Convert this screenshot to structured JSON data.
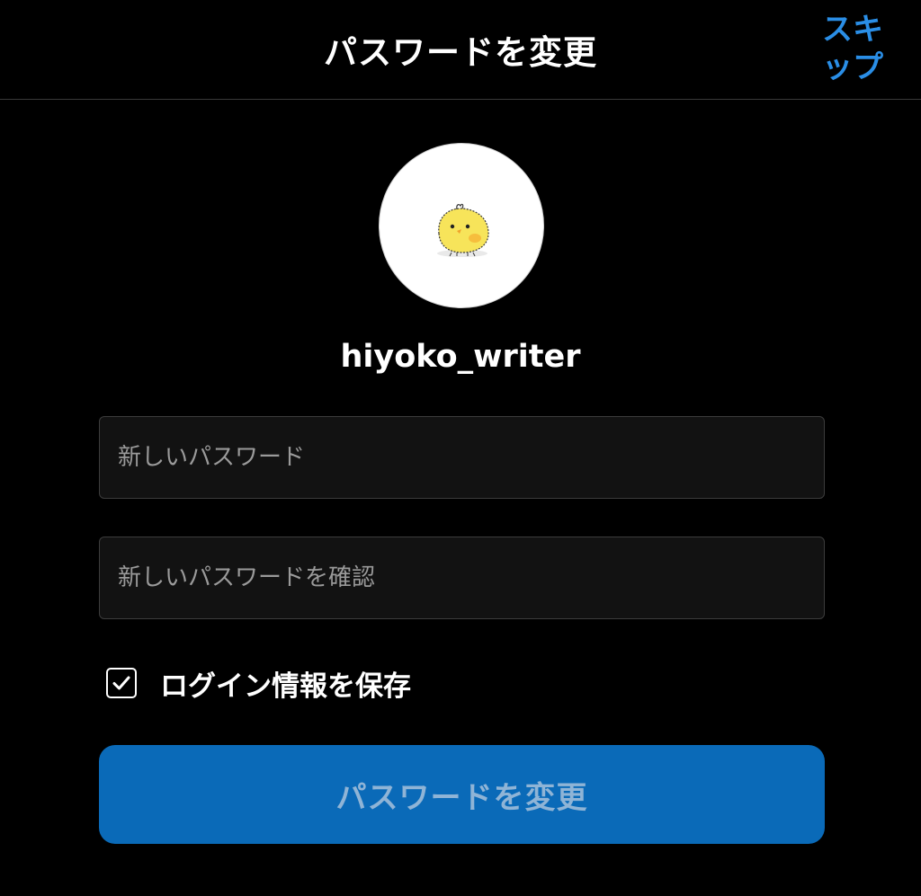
{
  "header": {
    "title": "パスワードを変更",
    "skip_label": "スキップ"
  },
  "profile": {
    "avatar_icon": "chick-avatar",
    "username": "hiyoko_writer"
  },
  "form": {
    "new_password": {
      "placeholder": "新しいパスワード",
      "value": ""
    },
    "confirm_password": {
      "placeholder": "新しいパスワードを確認",
      "value": ""
    },
    "save_login": {
      "label": "ログイン情報を保存",
      "checked": true,
      "icon": "check-icon"
    },
    "submit_label": "パスワードを変更"
  },
  "colors": {
    "background": "#000000",
    "accent": "#2a8ee6",
    "button": "#0a6ab8",
    "button_text_disabled": "#8fb4d6",
    "field_background": "#121212",
    "field_border": "#3c3c3c"
  }
}
